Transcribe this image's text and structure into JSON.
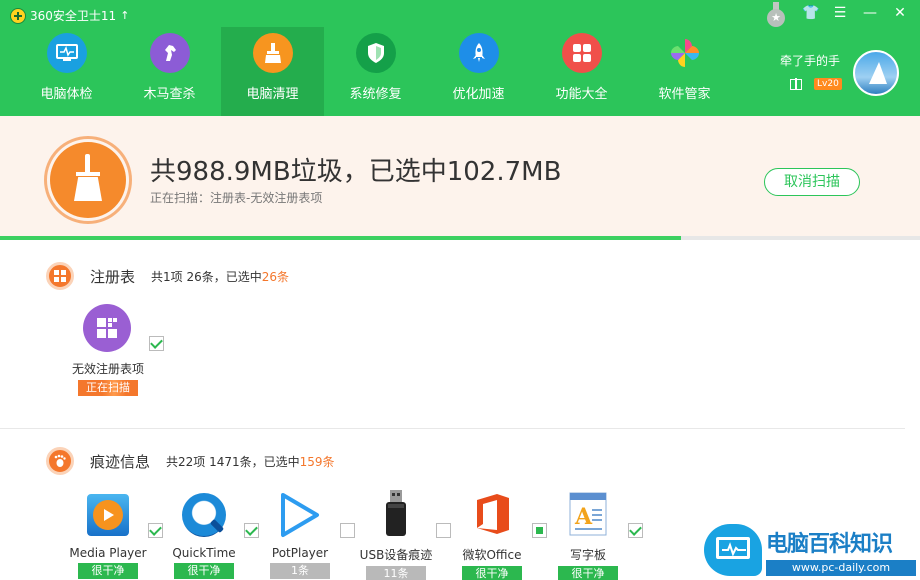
{
  "app": {
    "title": "360安全卫士11",
    "update_arrow": "↑"
  },
  "window_controls": {
    "skin": "👕",
    "menu": "☰",
    "minimize": "—",
    "close": "✕"
  },
  "nav": [
    {
      "label": "电脑体检"
    },
    {
      "label": "木马查杀"
    },
    {
      "label": "电脑清理",
      "active": true
    },
    {
      "label": "系统修复"
    },
    {
      "label": "优化加速"
    },
    {
      "label": "功能大全"
    },
    {
      "label": "软件管家"
    }
  ],
  "user": {
    "name": "牵了手的手",
    "level": "Lv20"
  },
  "scan": {
    "summary": "共988.9MB垃圾，已选中102.7MB",
    "status": "正在扫描：注册表-无效注册表项",
    "cancel_label": "取消扫描",
    "progress": 0.74
  },
  "sections": [
    {
      "title": "注册表",
      "summary_prefix": "共1项 26条，已选中",
      "summary_highlight": "26条",
      "items": [
        {
          "name": "无效注册表项",
          "tag": "正在扫描",
          "tag_style": "scanning",
          "checked": "on",
          "icon": "registry-icon"
        }
      ]
    },
    {
      "title": "痕迹信息",
      "summary_prefix": "共22项 1471条，已选中",
      "summary_highlight": "159条",
      "items": [
        {
          "name": "Media Player",
          "tag": "很干净",
          "tag_style": "green",
          "checked": "on",
          "icon": "media-player-icon"
        },
        {
          "name": "QuickTime",
          "tag": "很干净",
          "tag_style": "green",
          "checked": "on",
          "icon": "quicktime-icon"
        },
        {
          "name": "PotPlayer",
          "tag": "1条",
          "tag_style": "grey",
          "checked": "off",
          "icon": "potplayer-icon"
        },
        {
          "name": "USB设备痕迹",
          "tag": "11条",
          "tag_style": "grey",
          "checked": "off",
          "icon": "usb-drive-icon"
        },
        {
          "name": "微软Office",
          "tag": "很干净",
          "tag_style": "green",
          "checked": "partial",
          "icon": "office-icon"
        },
        {
          "name": "写字板",
          "tag": "很干净",
          "tag_style": "green",
          "checked": "on",
          "icon": "wordpad-icon"
        }
      ]
    }
  ],
  "watermark": {
    "title": "电脑百科知识",
    "url": "www.pc-daily.com"
  },
  "colors": {
    "brand_green": "#2cc55a",
    "accent_orange": "#f4772c",
    "banner_bg": "#fdf3ec"
  }
}
